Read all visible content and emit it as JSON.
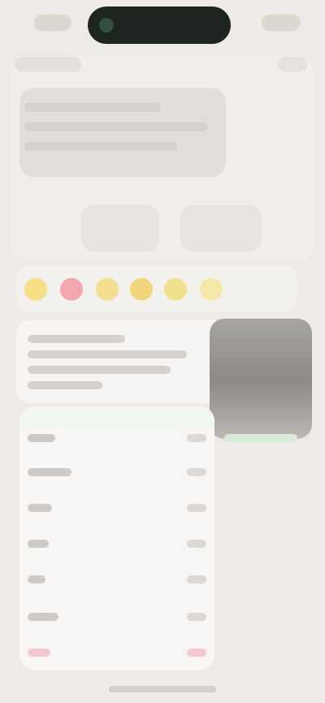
{
  "ui": {
    "status_bar": {
      "left": "",
      "center": "",
      "right": ""
    },
    "nav": {
      "back": "",
      "action": ""
    },
    "hero": {
      "line1": "",
      "line2": "",
      "line3": ""
    },
    "segments": [
      "",
      ""
    ],
    "ratings": [
      {
        "color": "#f6df87"
      },
      {
        "color": "#f1a7ab"
      },
      {
        "color": "#f2df8f"
      },
      {
        "color": "#f0d77c"
      },
      {
        "color": "#efe08d"
      },
      {
        "color": "#f4e7a8"
      }
    ],
    "description": {
      "line1": "",
      "line2": "",
      "line3": "",
      "line4": ""
    },
    "list": {
      "items": [
        {
          "label": "",
          "value": ""
        },
        {
          "label": "",
          "value": ""
        },
        {
          "label": "",
          "value": ""
        },
        {
          "label": "",
          "value": ""
        },
        {
          "label": "",
          "value": ""
        },
        {
          "label": "",
          "value": ""
        },
        {
          "label": "",
          "value": ""
        }
      ]
    },
    "colors": {
      "background": "#eeeae5",
      "card": "#f1eeea",
      "island": "#1e241f",
      "accent_green": "#d8ead8",
      "pink": "#f3c8d0"
    }
  }
}
